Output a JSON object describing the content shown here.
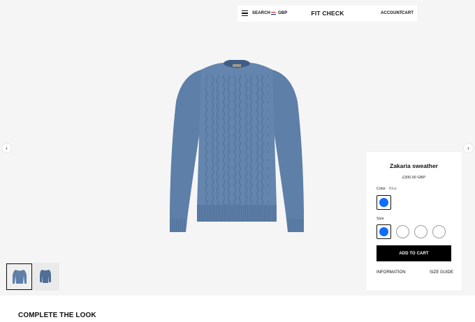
{
  "nav": {
    "search_label": "SEARCH",
    "currency": "GBP",
    "brand": "FIT CHECK",
    "account_label": "ACCOUNT",
    "cart_label": "CART"
  },
  "arrows": {
    "prev_icon": "‹",
    "next_icon": "›"
  },
  "product": {
    "name": "Zakaria sweather",
    "price": "£300.00 GBP",
    "color_label": "Color",
    "color_value": "Blue",
    "swatch_color": "#0d6efd",
    "sweater_color": "#5d7fa8",
    "size_label": "Size",
    "add_to_cart": "ADD TO CART",
    "information_label": "INFORMATION",
    "size_guide_label": "SIZE GUIDE"
  },
  "section": {
    "complete_the_look": "COMPLETE THE LOOK"
  }
}
